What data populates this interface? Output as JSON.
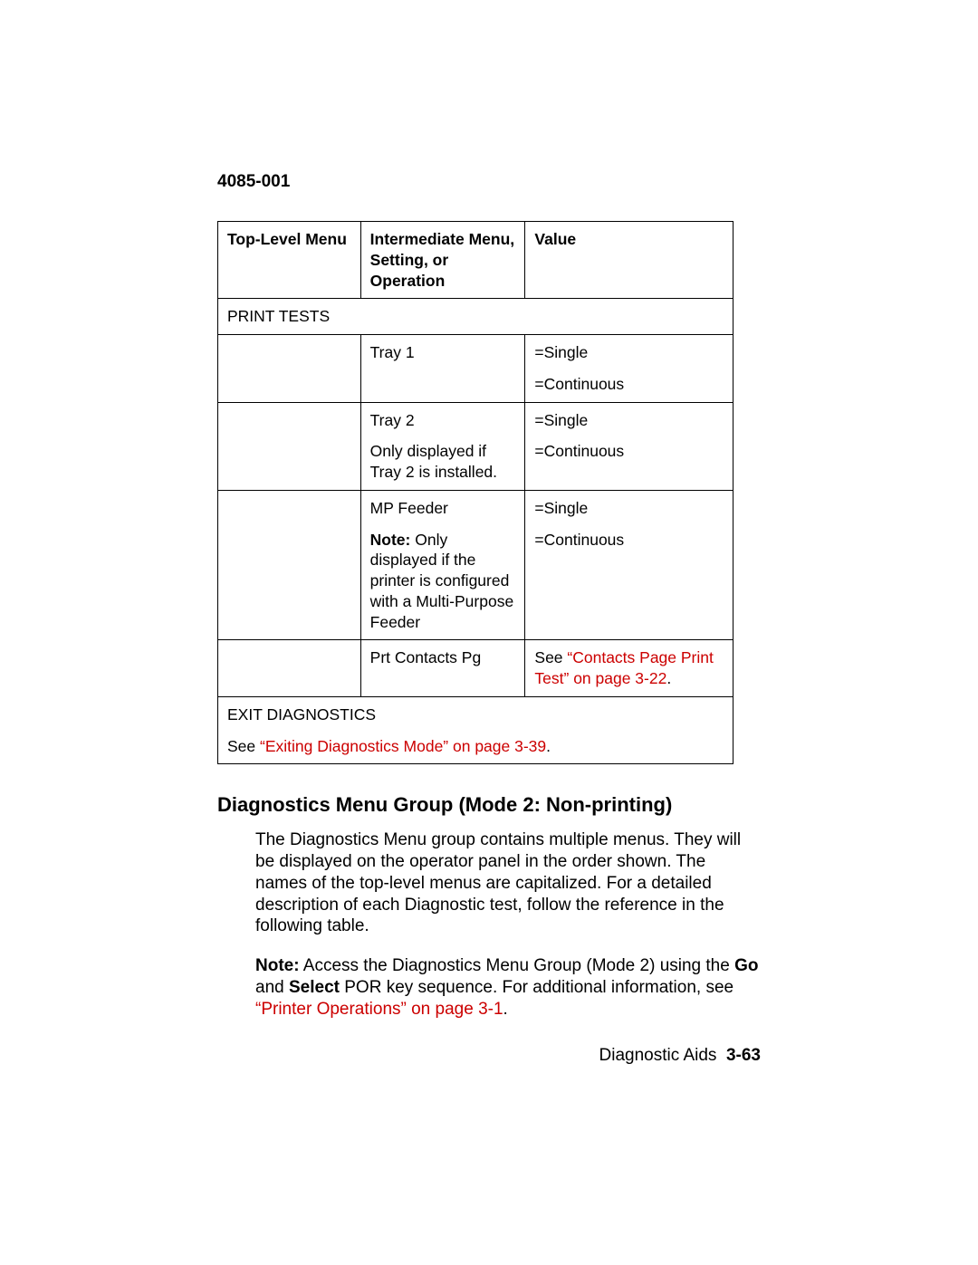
{
  "doc_num": "4085-001",
  "table": {
    "headers": {
      "col1": "Top-Level Menu",
      "col2": "Intermediate Menu, Setting, or Operation",
      "col3": "Value"
    },
    "print_tests_label": "PRINT TESTS",
    "rows": [
      {
        "col2_line1": "Tray 1",
        "col3_line1": "=Single",
        "col3_line2": "=Continuous"
      },
      {
        "col2_line1": "Tray 2",
        "col2_line2": "Only displayed if Tray 2 is installed.",
        "col3_line1": "=Single",
        "col3_line2": "=Continuous"
      },
      {
        "col2_line1": "MP Feeder",
        "col2_note_bold": "Note:",
        "col2_note_rest": "  Only displayed if the printer is configured with a Multi-Purpose Feeder",
        "col3_line1": "=Single",
        "col3_line2": "=Continuous"
      },
      {
        "col2_line1": "Prt Contacts Pg",
        "col3_prefix": "See ",
        "col3_link": "“Contacts Page Print Test” on page 3-22",
        "col3_suffix": "."
      }
    ],
    "exit_diag_label": "EXIT DIAGNOSTICS",
    "exit_prefix": "See ",
    "exit_link": "“Exiting Diagnostics Mode” on page 3-39",
    "exit_suffix": "."
  },
  "heading": "Diagnostics Menu Group (Mode 2: Non-printing)",
  "para1": "The Diagnostics Menu group contains multiple menus. They will be displayed on the operator panel in the order shown. The names of the top-level menus are capitalized. For a detailed description of each Diagnostic test, follow the reference in the following table.",
  "para2": {
    "note_bold": "Note:",
    "text1": "  Access the Diagnostics Menu Group (Mode 2) using the ",
    "go_bold": "Go",
    "text2": " and ",
    "select_bold": "Select",
    "text3": " POR key sequence. For additional information, see ",
    "link": "“Printer Operations” on page 3-1",
    "text4": "."
  },
  "footer": {
    "text": "Diagnostic Aids",
    "page": "3-63"
  }
}
